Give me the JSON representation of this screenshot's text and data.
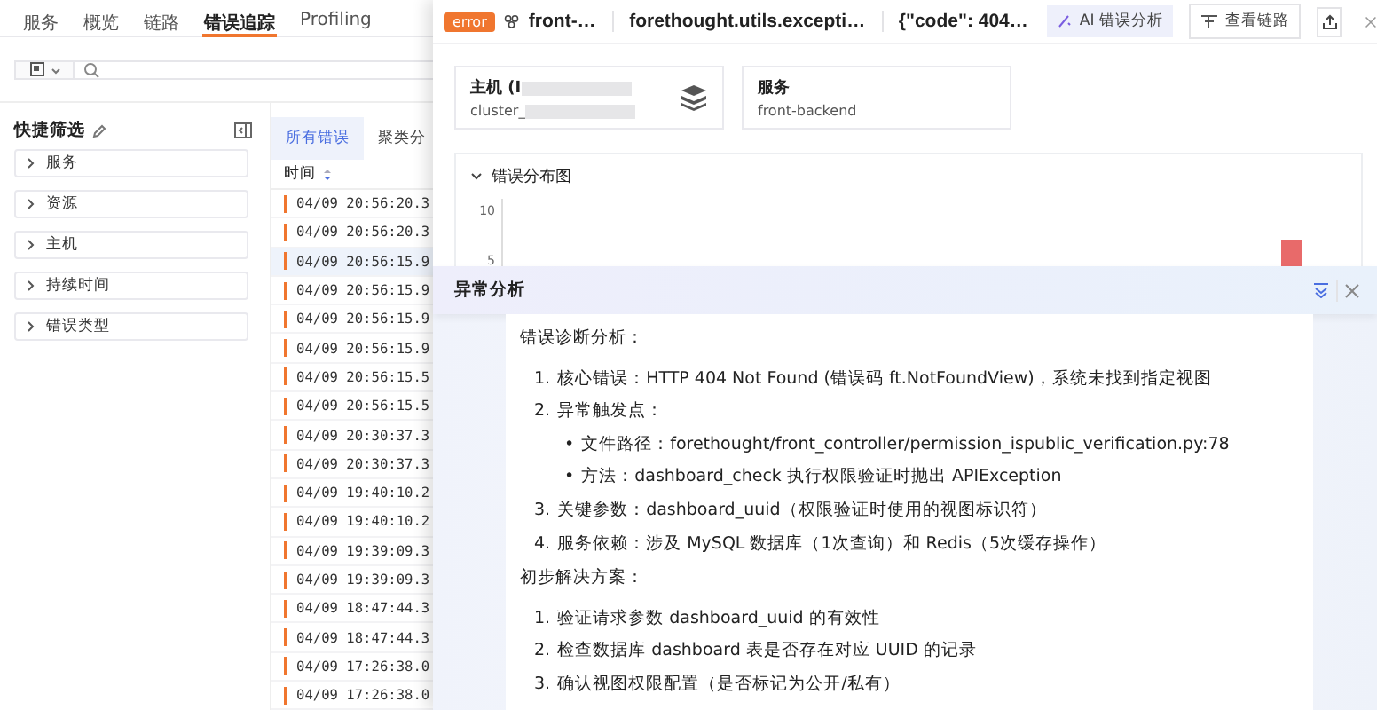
{
  "nav": {
    "tabs": [
      {
        "label": "服务",
        "selected": false
      },
      {
        "label": "概览",
        "selected": false
      },
      {
        "label": "链路",
        "selected": false
      },
      {
        "label": "错误追踪",
        "selected": true
      },
      {
        "label": "Profiling",
        "selected": false
      }
    ]
  },
  "quick_filter": {
    "title": "快捷筛选",
    "items": [
      {
        "label": "服务",
        "expanded": false
      },
      {
        "label": "资源",
        "expanded": false
      },
      {
        "label": "主机",
        "expanded": false
      },
      {
        "label": "持续时间",
        "expanded": false
      },
      {
        "label": "错误类型",
        "expanded": false
      }
    ]
  },
  "table": {
    "tabs": [
      {
        "label": "所有错误",
        "selected": true
      },
      {
        "label": "聚类分",
        "selected": false
      }
    ],
    "columns": [
      "时间"
    ],
    "rows": [
      {
        "time": "04/09 20:56:20.3",
        "selected": false
      },
      {
        "time": "04/09 20:56:20.3",
        "selected": false
      },
      {
        "time": "04/09 20:56:15.9",
        "selected": true
      },
      {
        "time": "04/09 20:56:15.9",
        "selected": false
      },
      {
        "time": "04/09 20:56:15.9",
        "selected": false
      },
      {
        "time": "04/09 20:56:15.9",
        "selected": false
      },
      {
        "time": "04/09 20:56:15.5",
        "selected": false
      },
      {
        "time": "04/09 20:56:15.5",
        "selected": false
      },
      {
        "time": "04/09 20:30:37.3",
        "selected": false
      },
      {
        "time": "04/09 20:30:37.3",
        "selected": false
      },
      {
        "time": "04/09 19:40:10.2",
        "selected": false
      },
      {
        "time": "04/09 19:40:10.2",
        "selected": false
      },
      {
        "time": "04/09 19:39:09.3",
        "selected": false
      },
      {
        "time": "04/09 19:39:09.3",
        "selected": false
      },
      {
        "time": "04/09 18:47:44.3",
        "selected": false
      },
      {
        "time": "04/09 18:47:44.3",
        "selected": false
      },
      {
        "time": "04/09 17:26:38.0",
        "selected": false
      },
      {
        "time": "04/09 17:26:38.0",
        "selected": false
      }
    ]
  },
  "drawer": {
    "status": "error",
    "service": "front-…",
    "exception": "forethought.utils.excepti…",
    "message": "{\"code\": 404…",
    "buttons": [
      {
        "kind": "ai",
        "label": "AI 错误分析"
      },
      {
        "kind": "trace",
        "label": "查看链路"
      },
      {
        "kind": "share"
      }
    ],
    "cards": [
      {
        "kind": "host",
        "title": "主机 (I",
        "value": "cluster_"
      },
      {
        "kind": "service",
        "title": "服务",
        "value": "front-backend"
      }
    ],
    "chart": {
      "title": "错误分布图",
      "expanded": true,
      "y_tick_labels": [
        "10",
        "5"
      ]
    }
  },
  "analysis": {
    "title": "异常分析",
    "content": [
      {
        "kind": "paragraph",
        "text": "错误诊断分析："
      },
      {
        "kind": "numbered",
        "marker": "1.",
        "text": "核心错误：HTTP 404 Not Found (错误码 ft.NotFoundView)，系统未找到指定视图"
      },
      {
        "kind": "numbered",
        "marker": "2.",
        "text": "异常触发点："
      },
      {
        "kind": "bullet",
        "marker": "•",
        "text": "文件路径：forethought/front_controller/permission_ispublic_verification.py:78"
      },
      {
        "kind": "bullet",
        "marker": "•",
        "text": "方法：dashboard_check 执行权限验证时抛出 APIException"
      },
      {
        "kind": "numbered",
        "marker": "3.",
        "text": "关键参数：dashboard_uuid（权限验证时使用的视图标识符）"
      },
      {
        "kind": "numbered",
        "marker": "4.",
        "text": "服务依赖：涉及 MySQL 数据库（1次查询）和 Redis（5次缓存操作）"
      },
      {
        "kind": "paragraph",
        "text": "初步解决方案："
      },
      {
        "kind": "numbered",
        "marker": "1.",
        "text": "验证请求参数 dashboard_uuid 的有效性"
      },
      {
        "kind": "numbered",
        "marker": "2.",
        "text": "检查数据库 dashboard 表是否存在对应 UUID 的记录"
      },
      {
        "kind": "numbered",
        "marker": "3.",
        "text": "确认视图权限配置（是否标记为公开/私有）"
      }
    ]
  }
}
